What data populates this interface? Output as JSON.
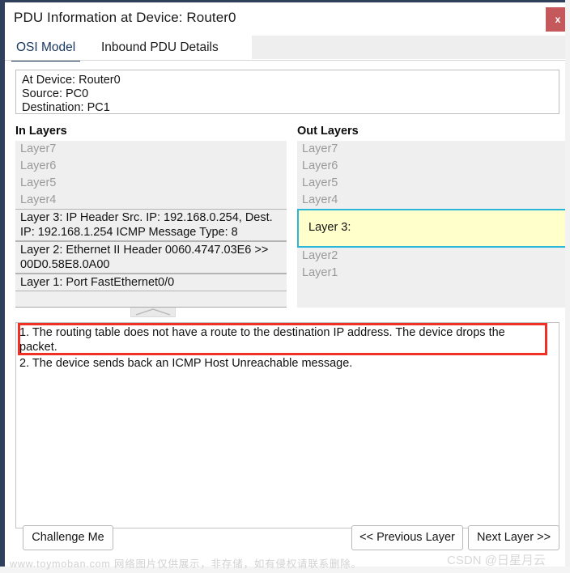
{
  "window": {
    "title": "PDU Information at Device: Router0",
    "close_label": "x",
    "accent_border": "#2f3f5c",
    "close_color": "#c4585b"
  },
  "tabs": [
    {
      "label": "OSI Model",
      "active": true
    },
    {
      "label": "Inbound PDU Details",
      "active": false
    }
  ],
  "info": {
    "at_device": "At Device: Router0",
    "source": "Source: PC0",
    "destination": "Destination: PC1"
  },
  "columns": {
    "in_heading": "In Layers",
    "out_heading": "Out Layers"
  },
  "in_layers": [
    {
      "text": "Layer7",
      "state": "dim"
    },
    {
      "text": "Layer6",
      "state": "dim"
    },
    {
      "text": "Layer5",
      "state": "dim"
    },
    {
      "text": "Layer4",
      "state": "dim"
    },
    {
      "text": "Layer 3: IP Header Src. IP: 192.168.0.254, Dest. IP: 192.168.1.254 ICMP Message Type: 8",
      "state": "filled"
    },
    {
      "text": "Layer 2: Ethernet II Header 0060.4747.03E6 >> 00D0.58E8.0A00",
      "state": "filled"
    },
    {
      "text": "Layer 1: Port FastEthernet0/0",
      "state": "filled"
    }
  ],
  "out_layers": [
    {
      "text": "Layer7",
      "state": "dim"
    },
    {
      "text": "Layer6",
      "state": "dim"
    },
    {
      "text": "Layer5",
      "state": "dim"
    },
    {
      "text": "Layer4",
      "state": "dim"
    },
    {
      "text": "Layer 3:",
      "state": "highlight"
    },
    {
      "text": "Layer2",
      "state": "dim"
    },
    {
      "text": "Layer1",
      "state": "dim"
    }
  ],
  "highlight": {
    "background": "#ffffcc",
    "border": "#29b6d8"
  },
  "description": {
    "item_1": "1. The routing table does not have a route to the destination IP address. The device drops the packet.",
    "item_2": "2. The device sends back an ICMP Host Unreachable message.",
    "highlight_color": "#f03024"
  },
  "footer": {
    "challenge": "Challenge Me",
    "previous": "<< Previous Layer",
    "next": "Next Layer >>"
  },
  "watermarks": {
    "left": "www.toymoban.com 网络图片仅供展示，非存储，如有侵权请联系删除。",
    "right": "CSDN @日星月云"
  }
}
